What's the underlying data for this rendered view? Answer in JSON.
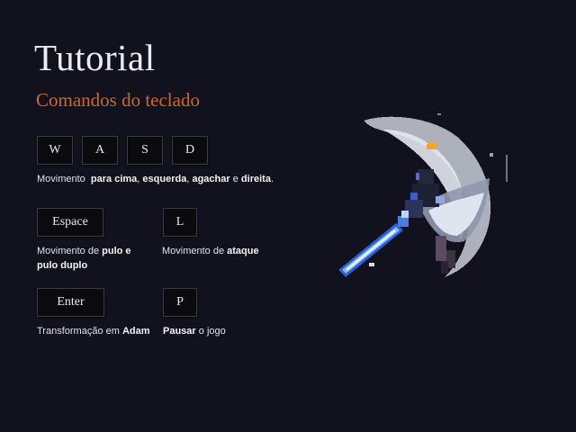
{
  "header": {
    "title": "Tutorial",
    "subtitle": "Comandos do teclado"
  },
  "keys": {
    "w": "W",
    "a": "A",
    "s": "S",
    "d": "D",
    "space": "Espace",
    "l": "L",
    "enter": "Enter",
    "p": "P"
  },
  "descriptions": {
    "move": {
      "prefix": "Movimento",
      "up": "para cima",
      "sep1": ",",
      "left": "esquerda",
      "sep2": ",",
      "crouch": "agachar",
      "and": "e",
      "right": "direita",
      "end": "."
    },
    "jump": {
      "prefix": "Movimento de",
      "bold": "pulo e pulo duplo"
    },
    "attack": {
      "prefix": "Movimento de",
      "bold": "ataque"
    },
    "transform": {
      "prefix": "Transformação em",
      "bold": "Adam"
    },
    "pause": {
      "bold": "Pausar",
      "suffix": "o jogo"
    }
  },
  "hero": {
    "icon": "knight-sword-slash-sprite"
  },
  "colors": {
    "background": "#11121e",
    "subtitle": "#c86a2c",
    "key_bg": "#0b0b0f",
    "key_border": "#3a3b45"
  }
}
